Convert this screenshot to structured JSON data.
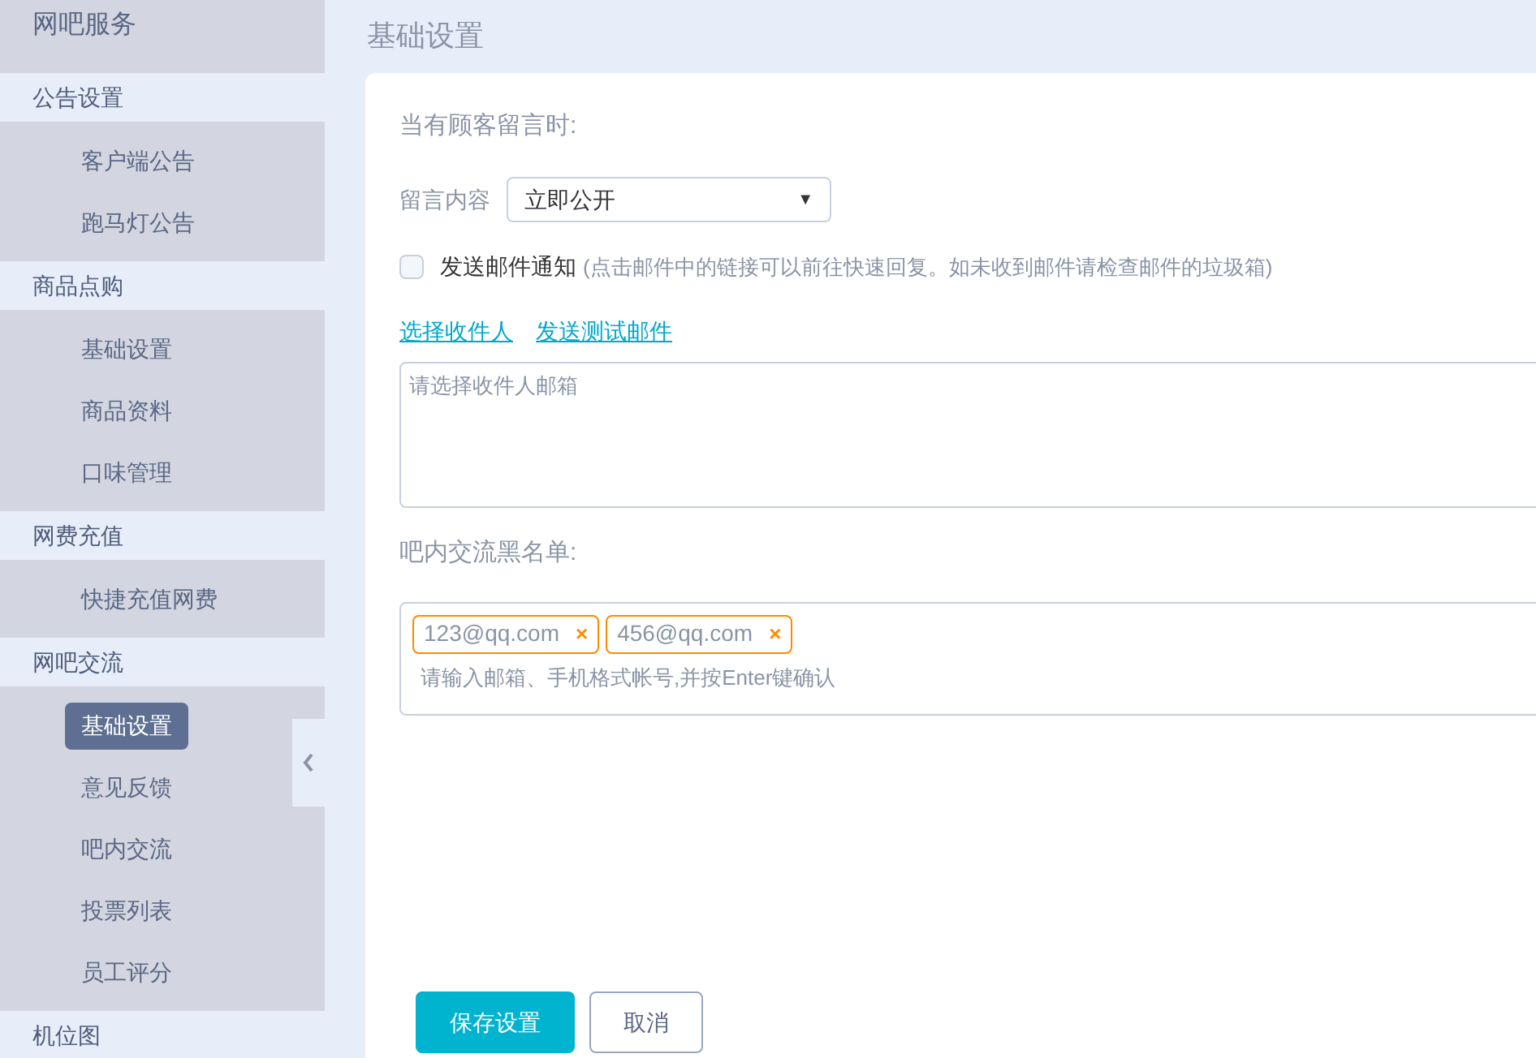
{
  "sidebar": {
    "title": "网吧服务",
    "groups": [
      {
        "label": "公告设置",
        "items": [
          {
            "label": "客户端公告",
            "selected": false
          },
          {
            "label": "跑马灯公告",
            "selected": false
          }
        ]
      },
      {
        "label": "商品点购",
        "items": [
          {
            "label": "基础设置",
            "selected": false
          },
          {
            "label": "商品资料",
            "selected": false
          },
          {
            "label": "口味管理",
            "selected": false
          }
        ]
      },
      {
        "label": "网费充值",
        "items": [
          {
            "label": "快捷充值网费",
            "selected": false
          }
        ]
      },
      {
        "label": "网吧交流",
        "items": [
          {
            "label": "基础设置",
            "selected": true
          },
          {
            "label": "意见反馈",
            "selected": false
          },
          {
            "label": "吧内交流",
            "selected": false
          },
          {
            "label": "投票列表",
            "selected": false
          },
          {
            "label": "员工评分",
            "selected": false
          }
        ]
      },
      {
        "label": "机位图"
      }
    ]
  },
  "page_title": "基础设置",
  "section_heading": "当有顾客留言时:",
  "message_select": {
    "label": "留言内容",
    "value": "立即公开",
    "arrow": "▼"
  },
  "email_notify": {
    "label": "发送邮件通知",
    "hint": "(点击邮件中的链接可以前往快速回复。如未收到邮件请检查邮件的垃圾箱)",
    "checked": false
  },
  "links": [
    "选择收件人",
    "发送测试邮件"
  ],
  "recipients": {
    "placeholder": "请选择收件人邮箱"
  },
  "blacklist": {
    "heading": "吧内交流黑名单:",
    "tags": [
      {
        "text": "123@qq.com",
        "remove": "×"
      },
      {
        "text": "456@qq.com",
        "remove": "×"
      }
    ],
    "placeholder": "请输入邮箱、手机格式帐号,并按Enter键确认"
  },
  "buttons": [
    {
      "label": "保存设置",
      "kind": "primary"
    },
    {
      "label": "取消",
      "kind": "secondary"
    }
  ]
}
